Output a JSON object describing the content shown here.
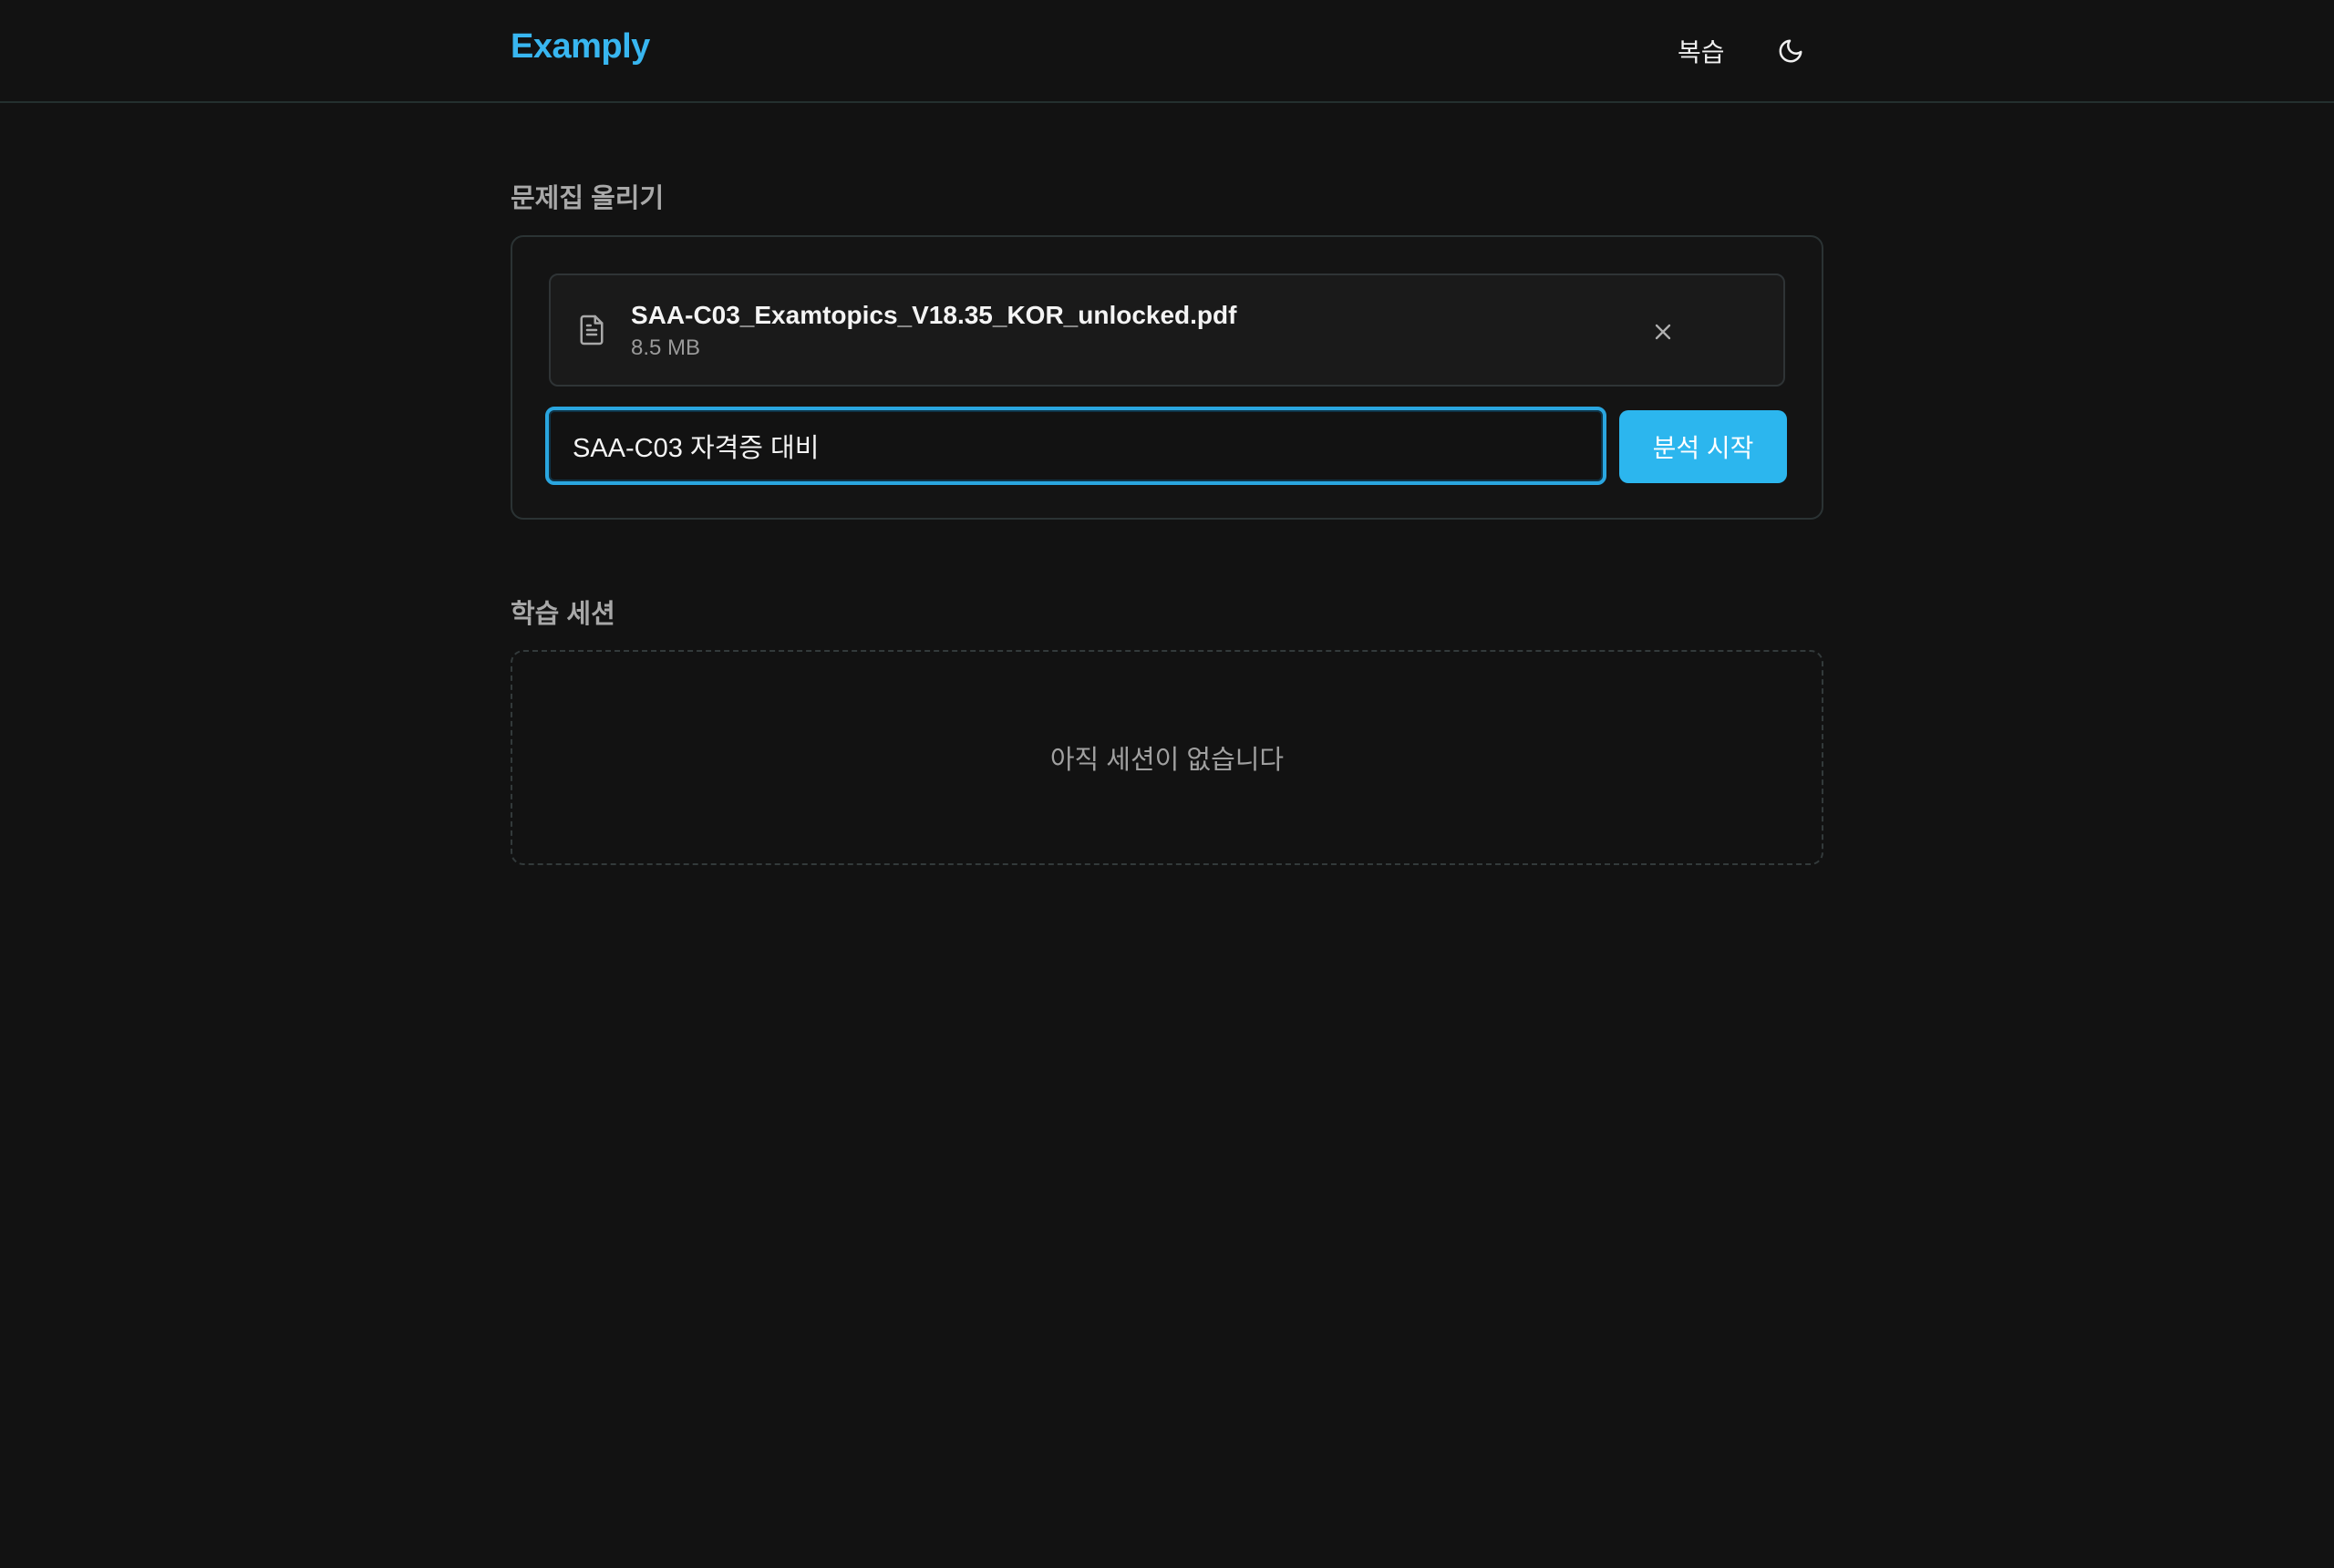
{
  "header": {
    "logo": "Examply",
    "nav_review": "복습",
    "theme_icon": "moon-icon"
  },
  "upload": {
    "section_title": "문제집 올리기",
    "file": {
      "icon": "file-text-icon",
      "name": "SAA-C03_Examtopics_V18.35_KOR_unlocked.pdf",
      "size": "8.5 MB",
      "remove_icon": "close-icon"
    },
    "title_input_value": "SAA-C03 자격증 대비",
    "start_label": "분석 시작"
  },
  "sessions": {
    "section_title": "학습 세션",
    "empty_text": "아직 세션이 없습니다"
  },
  "colors": {
    "background": "#121212",
    "accent": "#2cb6ee",
    "logo": "#38b6f0"
  }
}
